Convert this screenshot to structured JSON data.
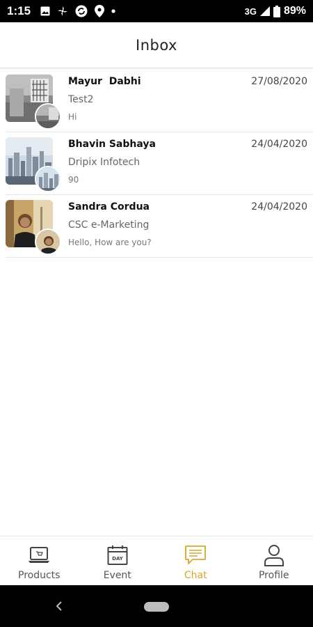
{
  "status_bar": {
    "time": "1:15",
    "network": "3G",
    "battery": "89%"
  },
  "header": {
    "title": "Inbox"
  },
  "chats": [
    {
      "name": "Mayur  Dabhi",
      "date": "27/08/2020",
      "company": "Test2",
      "preview": "Hi"
    },
    {
      "name": "Bhavin Sabhaya",
      "date": "24/04/2020",
      "company": "Dripix Infotech",
      "preview": "90"
    },
    {
      "name": "Sandra Cordua",
      "date": "24/04/2020",
      "company": "CSC e-Marketing",
      "preview": "Hello, How are you?"
    }
  ],
  "bottom_nav": {
    "items": [
      {
        "label": "Products",
        "icon": "laptop-icon",
        "active": false
      },
      {
        "label": "Event",
        "icon": "calendar-day-icon",
        "active": false
      },
      {
        "label": "Chat",
        "icon": "chat-icon",
        "active": true
      },
      {
        "label": "Profile",
        "icon": "person-icon",
        "active": false
      }
    ]
  },
  "colors": {
    "accent": "#d9a62e",
    "text_primary": "#111111",
    "text_secondary": "#666666"
  }
}
